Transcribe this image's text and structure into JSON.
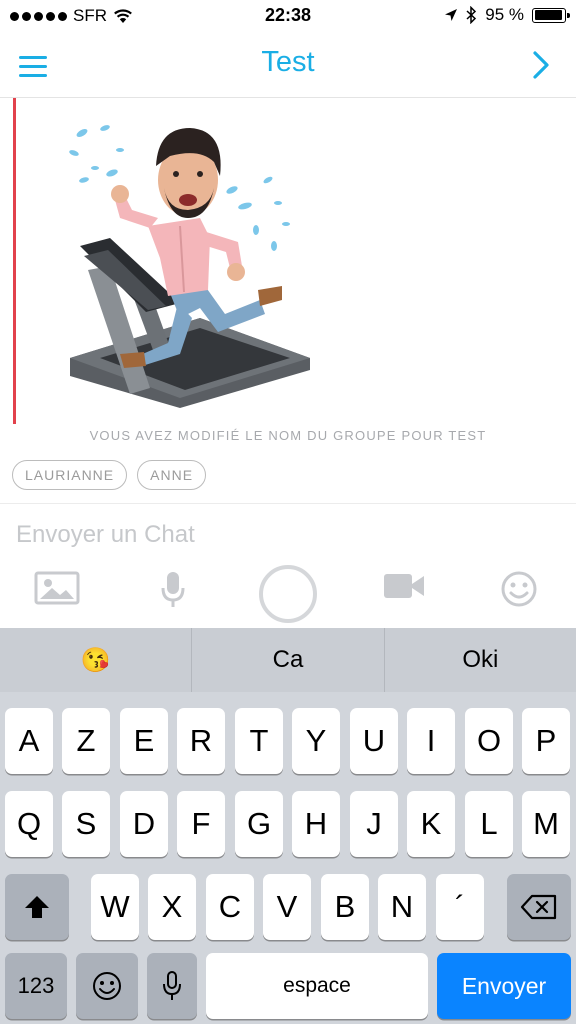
{
  "status_bar": {
    "carrier": "SFR",
    "time": "22:38",
    "battery": "95 %",
    "battery_level": 0.95
  },
  "nav": {
    "title": "Test",
    "menu_icon": "hamburger-menu-icon",
    "next_icon": "chevron-right-icon"
  },
  "chat": {
    "sticker": "bitmoji-treadmill-sticker",
    "system_message": "VOUS AVEZ MODIFIÉ LE NOM DU GROUPE POUR TEST",
    "members": [
      "LAURIANNE",
      "ANNE"
    ]
  },
  "composer": {
    "placeholder": "Envoyer un Chat",
    "value": "",
    "actions": [
      "image-icon",
      "microphone-icon",
      "camera-shutter-button",
      "video-camera-icon",
      "smiley-icon"
    ]
  },
  "keyboard": {
    "suggestions": [
      "😘",
      "Ca",
      "Oki"
    ],
    "row1": [
      "A",
      "Z",
      "E",
      "R",
      "T",
      "Y",
      "U",
      "I",
      "O",
      "P"
    ],
    "row2": [
      "Q",
      "S",
      "D",
      "F",
      "G",
      "H",
      "J",
      "K",
      "L",
      "M"
    ],
    "row3": [
      "W",
      "X",
      "C",
      "V",
      "B",
      "N",
      "´"
    ],
    "numbers_key": "123",
    "space_key": "espace",
    "send_key": "Envoyer",
    "colors": {
      "send": "#0a84ff",
      "accent": "#1aaee5"
    }
  }
}
